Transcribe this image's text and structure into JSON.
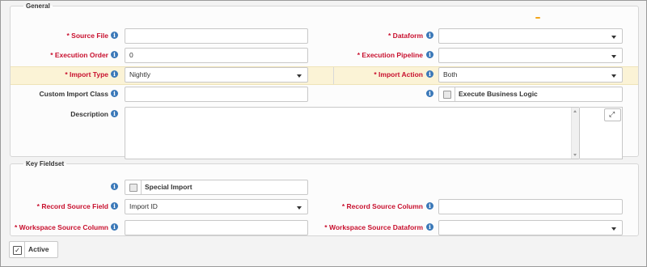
{
  "general": {
    "legend": "General",
    "source_file": {
      "label": "* Source File",
      "value": ""
    },
    "dataform": {
      "label": "* Dataform",
      "value": ""
    },
    "execution_order": {
      "label": "* Execution Order",
      "value": "0"
    },
    "execution_pipeline": {
      "label": "* Execution Pipeline",
      "value": ""
    },
    "import_type": {
      "label": "* Import Type",
      "value": "Nightly"
    },
    "import_action": {
      "label": "* Import Action",
      "value": "Both"
    },
    "custom_import_class": {
      "label": "Custom Import Class",
      "value": ""
    },
    "execute_business_logic": {
      "label": "Execute Business Logic",
      "checked": false
    },
    "description": {
      "label": "Description",
      "value": ""
    }
  },
  "key_fieldset": {
    "legend": "Key Fieldset",
    "special_import": {
      "label": "Special Import",
      "checked": false
    },
    "record_source_field": {
      "label": "* Record Source Field",
      "value": "Import ID"
    },
    "record_source_column": {
      "label": "* Record Source Column",
      "value": ""
    },
    "workspace_source_column": {
      "label": "* Workspace Source Column",
      "value": ""
    },
    "workspace_source_dataform": {
      "label": "* Workspace Source Dataform",
      "value": ""
    }
  },
  "active": {
    "label": "Active",
    "checked": true
  },
  "icons": {
    "info": "info-icon",
    "expand": "expand-icon",
    "caret": "chevron-down-icon",
    "check": "check-icon"
  },
  "colors": {
    "required": "#c8102e",
    "info": "#3a78b8",
    "highlight_row": "#fbf3d6",
    "accent_handle": "#f2a51b"
  }
}
